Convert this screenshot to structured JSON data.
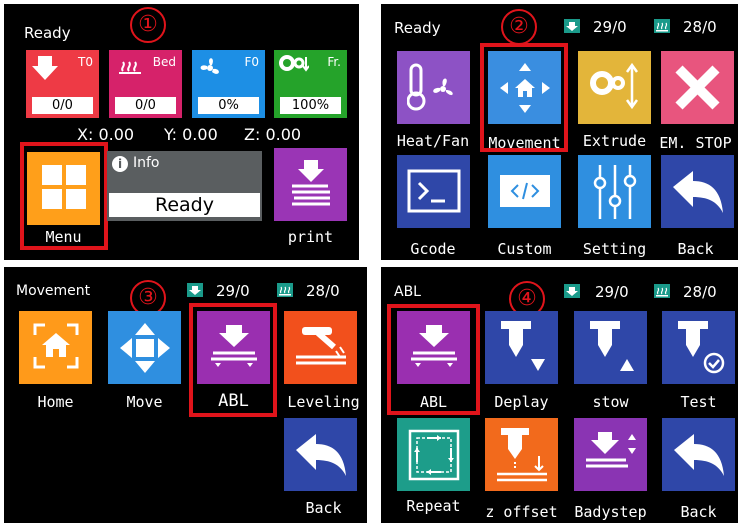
{
  "markers": [
    "①",
    "②",
    "③",
    "④"
  ],
  "colors": {
    "highlight": "#e0141b",
    "extruder": "#ee3a45",
    "bed": "#d6226a",
    "fan": "#1d8fe5",
    "speed": "#25a32a",
    "menu": "#ff9f1a",
    "info_bg": "#5a5e60",
    "print": "#9a35b5",
    "purple": "#8d52c5",
    "blue": "#3a8ee0",
    "yellow": "#e3b53a",
    "pink": "#e8557e",
    "navy": "#2f47a8",
    "teal": "#1d9d8a",
    "orange": "#f26a1c",
    "abl": "#9a2fb0",
    "white_text": "#ffffff"
  },
  "screen1": {
    "status": "Ready",
    "temps": [
      {
        "label": "T0",
        "value": "0/0",
        "icon": "extruder-down-icon"
      },
      {
        "label": "Bed",
        "value": "0/0",
        "icon": "heat-waves-icon"
      },
      {
        "label": "F0",
        "value": "0%",
        "icon": "fan-icon"
      },
      {
        "label": "Fr.",
        "value": "100%",
        "icon": "gear-speed-icon"
      }
    ],
    "coords": {
      "x": "X: 0.00",
      "y": "Y: 0.00",
      "z": "Z: 0.00"
    },
    "menu_label": "Menu",
    "info_title": "Info",
    "info_status": "Ready",
    "print_label": "print"
  },
  "screen2": {
    "status": "Ready",
    "extruder_temp": "29/0",
    "bed_temp": "28/0",
    "tiles": [
      "Heat/Fan",
      "Movement",
      "Extrude",
      "EM. STOP",
      "Gcode",
      "Custom",
      "Setting",
      "Back"
    ]
  },
  "screen3": {
    "status": "Movement",
    "extruder_temp": "29/0",
    "bed_temp": "28/0",
    "tiles": [
      "Home",
      "Move",
      "ABL",
      "Leveling",
      "Back"
    ]
  },
  "screen4": {
    "status": "ABL",
    "extruder_temp": "29/0",
    "bed_temp": "28/0",
    "tiles": [
      "ABL",
      "Deplay",
      "stow",
      "Test",
      "Repeat",
      "z offset",
      "Badystep",
      "Back"
    ]
  }
}
